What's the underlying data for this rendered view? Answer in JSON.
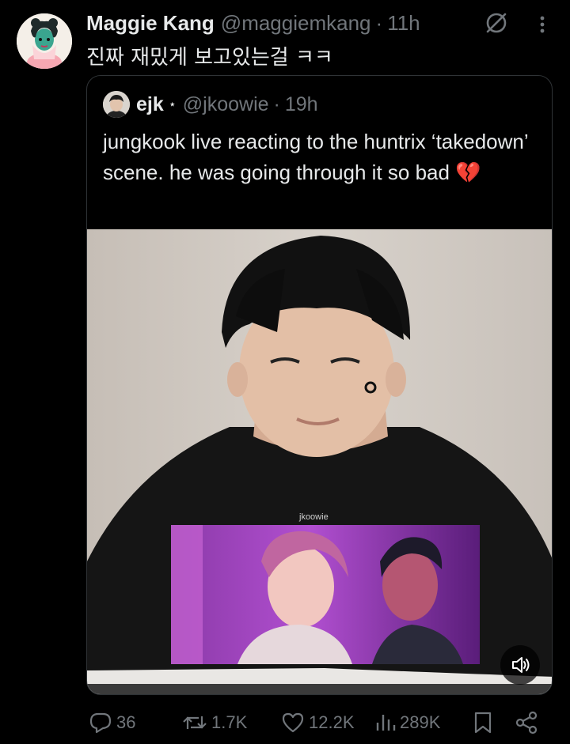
{
  "tweet": {
    "display_name": "Maggie Kang",
    "handle": "@maggiemkang",
    "separator": "·",
    "time": "11h",
    "text": "진짜 재밌게 보고있는걸 ㅋㅋ"
  },
  "quote": {
    "display_name": "ejk",
    "star": "⋆",
    "handle": "@jkoowie",
    "separator": "·",
    "time": "19h",
    "text": "jungkook live reacting to the huntrix ‘takedown’ scene. he was going through it so bad",
    "emoji": "💔",
    "watermark": "jkoowie"
  },
  "actions": {
    "replies": "36",
    "reposts": "1.7K",
    "likes": "12.2K",
    "views": "289K"
  },
  "colors": {
    "background": "#000000",
    "text": "#e7e9ea",
    "muted": "#71767b",
    "border": "#2f3336"
  }
}
